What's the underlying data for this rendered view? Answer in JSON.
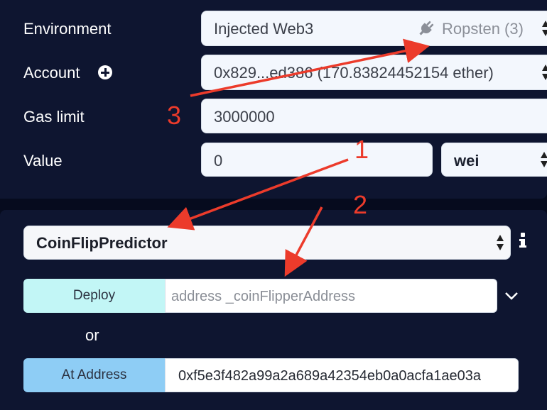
{
  "environment": {
    "label": "Environment",
    "value": "Injected Web3",
    "network": "Ropsten (3)"
  },
  "account": {
    "label": "Account",
    "value": "0x829...ed386 (170.83824452154 ether)"
  },
  "gas_limit": {
    "label": "Gas limit",
    "value": "3000000"
  },
  "value_field": {
    "label": "Value",
    "value": "0",
    "unit": "wei"
  },
  "contract": {
    "selected": "CoinFlipPredictor",
    "info_glyph": "i"
  },
  "deploy": {
    "button": "Deploy",
    "placeholder": "address _coinFlipperAddress"
  },
  "or_text": "or",
  "at_address": {
    "button": "At Address",
    "value": "0xf5e3f482a99a2a689a42354eb0a0acfa1ae03a"
  },
  "annotations": {
    "one": "1",
    "two": "2",
    "three": "3"
  },
  "colors": {
    "background": "#060b1e",
    "panel": "#0e1530",
    "deploy_button": "#c2f6f6",
    "at_address_button": "#8ecdf5",
    "annotation": "#ec3b2b"
  }
}
